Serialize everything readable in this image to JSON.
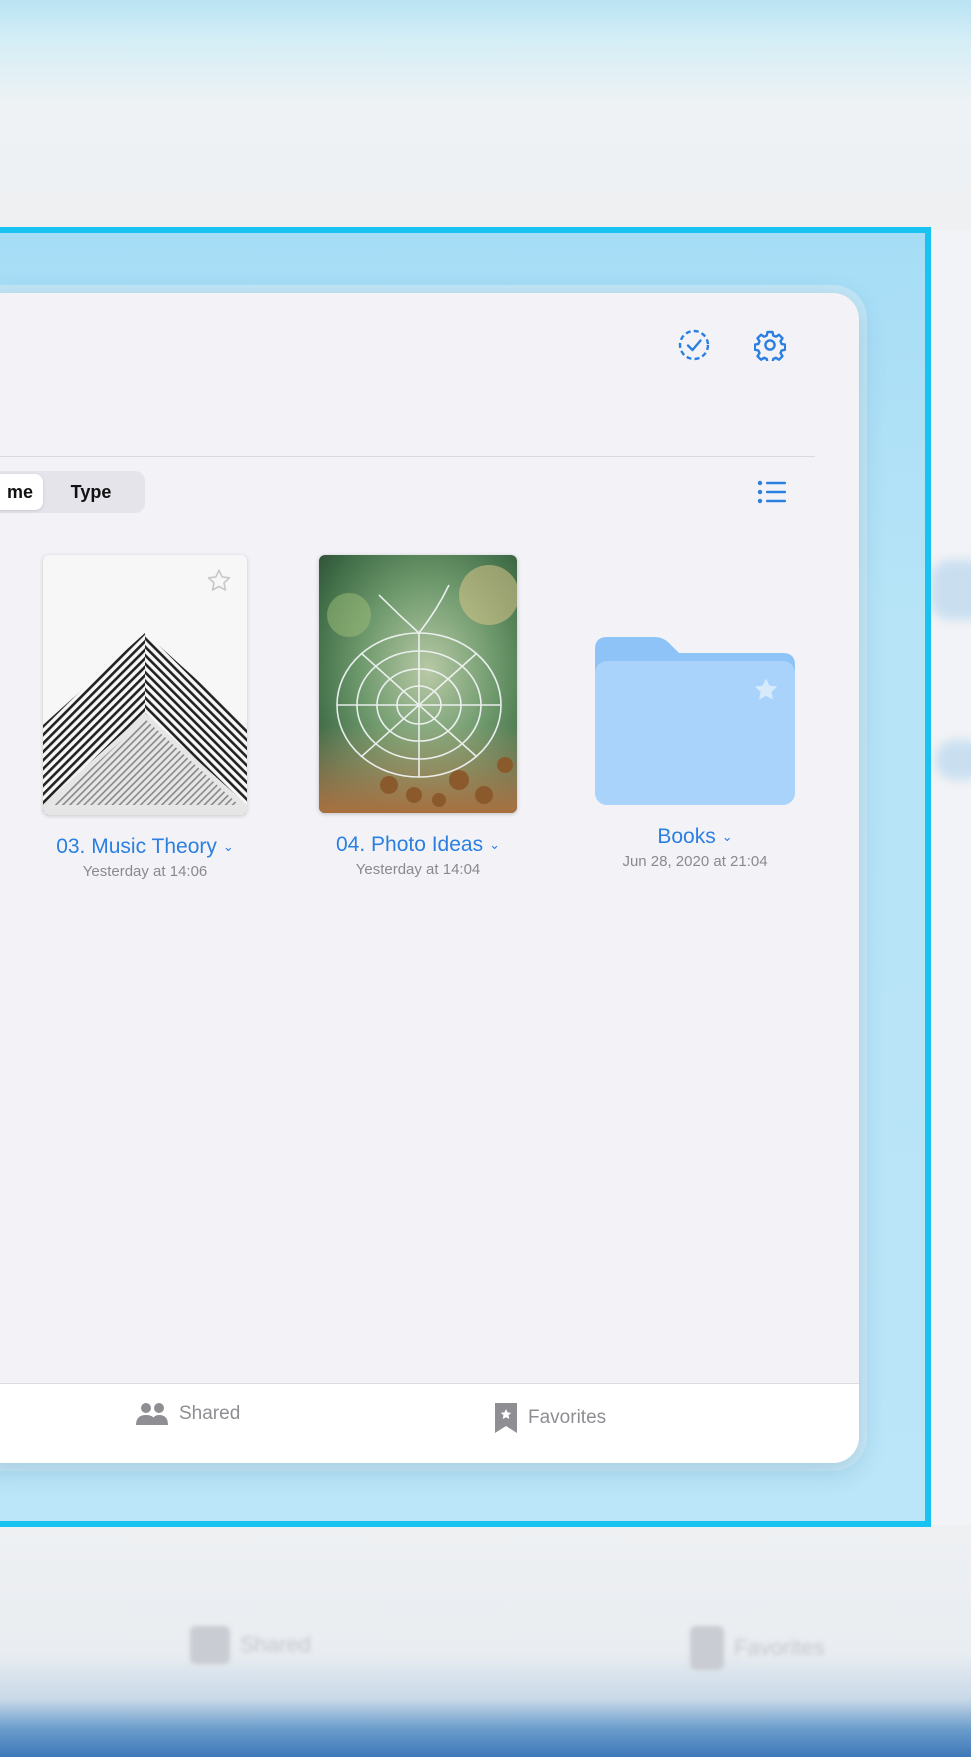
{
  "toolbar": {
    "select_icon": "dashed-check-circle-icon",
    "settings_icon": "gear-icon",
    "list_view_icon": "list-icon"
  },
  "sort": {
    "options": [
      "Name",
      "Type"
    ],
    "visible_labels": [
      "me",
      "Type"
    ],
    "selected": "Name"
  },
  "items": [
    {
      "title": "03. Music Theory",
      "date": "Yesterday at 14:06",
      "kind": "notebook",
      "favorite": false
    },
    {
      "title": "04. Photo Ideas",
      "date": "Yesterday at 14:04",
      "kind": "notebook",
      "favorite": false
    },
    {
      "title": "Books",
      "date": "Jun 28, 2020 at 21:04",
      "kind": "folder",
      "favorite": false
    }
  ],
  "tabbar": {
    "shared_label": "Shared",
    "favorites_label": "Favorites"
  },
  "colors": {
    "accent": "#2b7fe0",
    "highlight_frame": "#19c3f1",
    "folder": "#a9d3fb",
    "folder_tab": "#8ec3f7"
  }
}
